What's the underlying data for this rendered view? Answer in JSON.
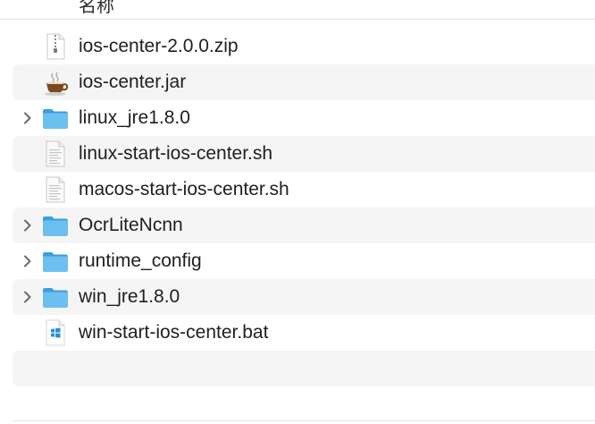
{
  "header": {
    "partial_label": "名称"
  },
  "files": [
    {
      "name": "ios-center-2.0.0.zip",
      "kind": "zip",
      "icon": "zip-archive-icon",
      "expandable": false
    },
    {
      "name": "ios-center.jar",
      "kind": "jar",
      "icon": "java-coffee-icon",
      "expandable": false
    },
    {
      "name": "linux_jre1.8.0",
      "kind": "folder",
      "icon": "folder-icon",
      "expandable": true
    },
    {
      "name": "linux-start-ios-center.sh",
      "kind": "script",
      "icon": "script-document-icon",
      "expandable": false
    },
    {
      "name": "macos-start-ios-center.sh",
      "kind": "script",
      "icon": "script-document-icon",
      "expandable": false
    },
    {
      "name": "OcrLiteNcnn",
      "kind": "folder",
      "icon": "folder-icon",
      "expandable": true
    },
    {
      "name": "runtime_config",
      "kind": "folder",
      "icon": "folder-icon",
      "expandable": true
    },
    {
      "name": "win_jre1.8.0",
      "kind": "folder",
      "icon": "folder-icon",
      "expandable": true
    },
    {
      "name": "win-start-ios-center.bat",
      "kind": "bat",
      "icon": "windows-document-icon",
      "expandable": false
    }
  ],
  "colors": {
    "row_stripe": "#f5f5f5",
    "folder_blue": "#5ab4ea",
    "text": "#1f1f1f"
  }
}
